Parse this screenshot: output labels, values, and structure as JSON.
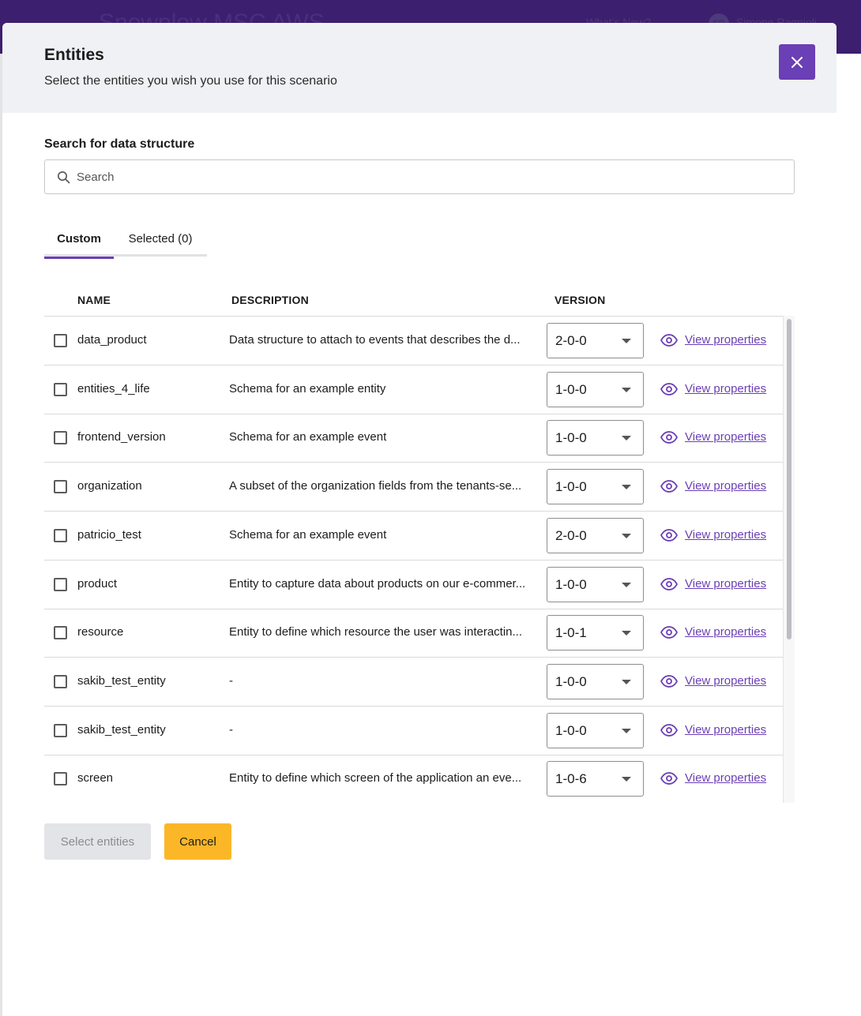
{
  "background": {
    "app_title": "Snowplow MSC AWS",
    "whats_new": "What's New?",
    "user_initials": "SR",
    "user_name": "Simone Ragnioli"
  },
  "modal": {
    "title": "Entities",
    "subtitle": "Select the entities you wish you use for this scenario",
    "close_icon": "close-icon"
  },
  "search": {
    "label": "Search for data structure",
    "placeholder": "Search",
    "value": ""
  },
  "tabs": [
    {
      "label": "Custom",
      "active": true
    },
    {
      "label": "Selected (0)",
      "active": false
    }
  ],
  "table": {
    "headers": {
      "name": "NAME",
      "description": "DESCRIPTION",
      "version": "VERSION"
    },
    "rows": [
      {
        "name": "data_product",
        "description": "Data structure to attach to events that describes the d...",
        "version": "2-0-0",
        "link": "View properties"
      },
      {
        "name": "entities_4_life",
        "description": "Schema for an example entity",
        "version": "1-0-0",
        "link": "View properties"
      },
      {
        "name": "frontend_version",
        "description": "Schema for an example event",
        "version": "1-0-0",
        "link": "View properties"
      },
      {
        "name": "organization",
        "description": "A subset of the organization fields from the tenants-se...",
        "version": "1-0-0",
        "link": "View properties"
      },
      {
        "name": "patricio_test",
        "description": "Schema for an example event",
        "version": "2-0-0",
        "link": "View properties"
      },
      {
        "name": "product",
        "description": "Entity to capture data about products on our e-commer...",
        "version": "1-0-0",
        "link": "View properties"
      },
      {
        "name": "resource",
        "description": "Entity to define which resource the user was interactin...",
        "version": "1-0-1",
        "link": "View properties"
      },
      {
        "name": "sakib_test_entity",
        "description": "-",
        "version": "1-0-0",
        "link": "View properties"
      },
      {
        "name": "sakib_test_entity",
        "description": "-",
        "version": "1-0-0",
        "link": "View properties"
      },
      {
        "name": "screen",
        "description": "Entity to define which screen of the application an eve...",
        "version": "1-0-6",
        "link": "View properties"
      }
    ]
  },
  "footer": {
    "select_label": "Select entities",
    "cancel_label": "Cancel"
  },
  "colors": {
    "accent": "#6b3fb5",
    "cancel": "#fbb727",
    "header_bg": "#3c1f6e"
  }
}
